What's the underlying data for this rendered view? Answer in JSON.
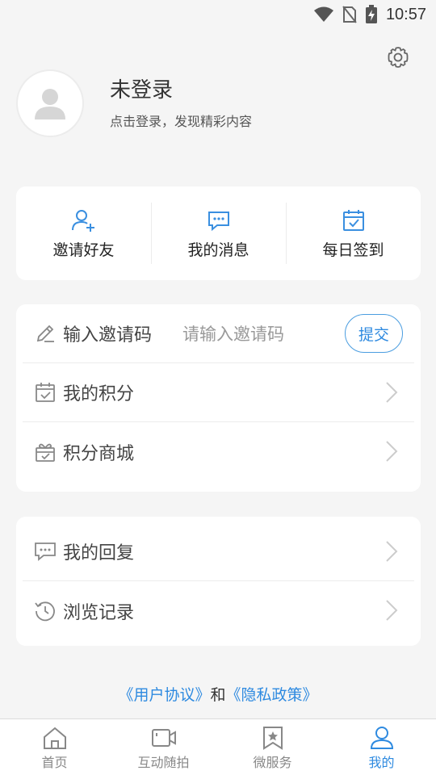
{
  "status_bar": {
    "time": "10:57"
  },
  "profile": {
    "name": "未登录",
    "subtitle": "点击登录，发现精彩内容"
  },
  "quick_actions": [
    {
      "label": "邀请好友",
      "icon": "add-user-icon"
    },
    {
      "label": "我的消息",
      "icon": "chat-icon"
    },
    {
      "label": "每日签到",
      "icon": "calendar-check-icon"
    }
  ],
  "invite": {
    "label": "输入邀请码",
    "placeholder": "请输入邀请码",
    "submit": "提交"
  },
  "list1": [
    {
      "label": "我的积分",
      "icon": "points-calendar-icon"
    },
    {
      "label": "积分商城",
      "icon": "gift-box-icon"
    }
  ],
  "list2": [
    {
      "label": "我的回复",
      "icon": "reply-bubble-icon"
    },
    {
      "label": "浏览记录",
      "icon": "history-clock-icon"
    }
  ],
  "agreement": {
    "link1": "《用户协议》",
    "and": "和",
    "link2": "《隐私政策》"
  },
  "nav": [
    {
      "label": "首页",
      "icon": "home-icon"
    },
    {
      "label": "互动随拍",
      "icon": "video-camera-icon"
    },
    {
      "label": "微服务",
      "icon": "bookmark-star-icon"
    },
    {
      "label": "我的",
      "icon": "user-icon"
    }
  ],
  "colors": {
    "accent": "#2e8ae0",
    "background": "#f5f5f5",
    "card": "#ffffff"
  }
}
